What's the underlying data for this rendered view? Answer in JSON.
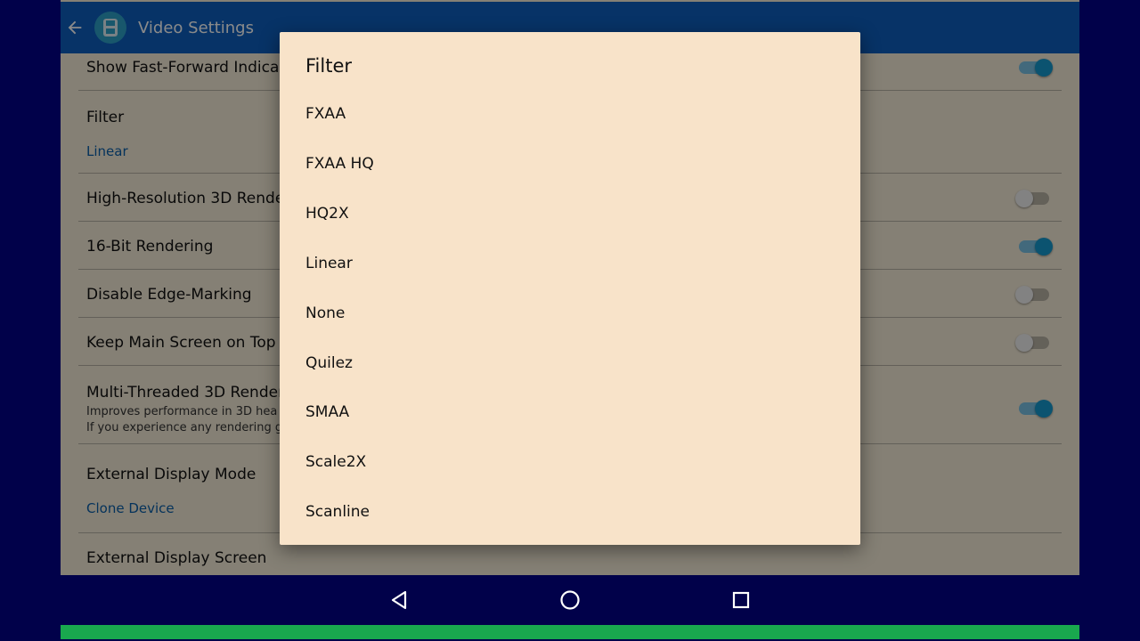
{
  "appbar": {
    "title": "Video Settings",
    "back_icon": "arrow-left-icon",
    "app_icon": "nintendo-ds-icon",
    "color": "#0d5fbf"
  },
  "settings": {
    "show_ff": {
      "title": "Show Fast-Forward Indica",
      "enabled": true
    },
    "filter": {
      "title": "Filter",
      "value": "Linear"
    },
    "hires": {
      "title": "High-Resolution 3D Rende",
      "enabled": false
    },
    "bit16": {
      "title": "16-Bit Rendering",
      "enabled": true
    },
    "edge": {
      "title": "Disable Edge-Marking",
      "enabled": false
    },
    "keep_main": {
      "title": "Keep Main Screen on Top",
      "enabled": false
    },
    "multithread": {
      "title": "Multi-Threaded 3D Render",
      "desc1": "Improves performance in 3D hea",
      "desc2": "If you experience any rendering g",
      "enabled": true
    },
    "ext_mode": {
      "title": "External Display Mode",
      "value": "Clone Device"
    },
    "ext_screen": {
      "title": "External Display Screen"
    }
  },
  "dialog": {
    "title": "Filter",
    "options": [
      "FXAA",
      "FXAA HQ",
      "HQ2X",
      "Linear",
      "None",
      "Quilez",
      "SMAA",
      "Scale2X",
      "Scanline"
    ]
  },
  "navbar": {
    "back_icon": "nav-back-icon",
    "home_icon": "nav-home-icon",
    "recents_icon": "nav-recents-icon"
  },
  "colors": {
    "accent": "#1599cf",
    "link": "#0b5ea8",
    "dialog_bg": "#f8e3c9",
    "frame": "#01014a",
    "green_bar": "#19a84e"
  }
}
